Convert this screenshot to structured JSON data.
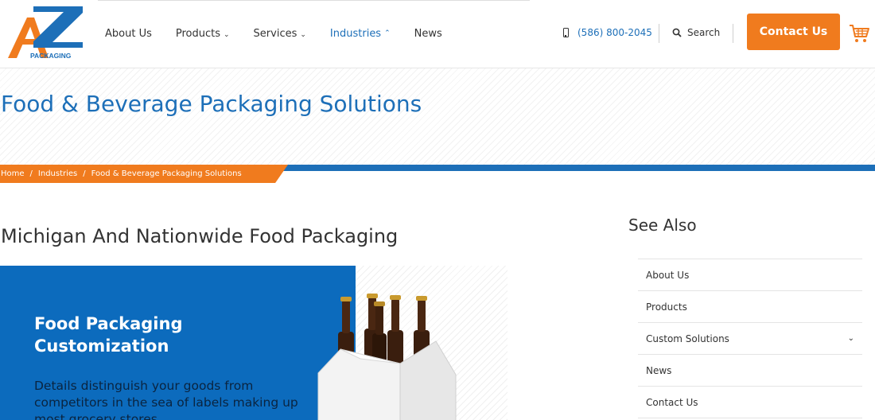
{
  "brand": {
    "logo_text": "AZ",
    "logo_subtext": "PACKAGING",
    "orange": "#f07b1e",
    "blue": "#1d6fb8"
  },
  "nav": {
    "items": [
      {
        "label": "About Us",
        "icon": ""
      },
      {
        "label": "Products",
        "icon": "chevron-down-icon"
      },
      {
        "label": "Services",
        "icon": "chevron-down-icon"
      },
      {
        "label": "Industries",
        "icon": "chevron-up-icon",
        "active": true
      },
      {
        "label": "News",
        "icon": ""
      }
    ]
  },
  "header": {
    "phone": "(586) 800-2045",
    "phone_icon": "mobile-phone-icon",
    "search_label": "Search",
    "search_icon": "search-icon",
    "contact_label": "Contact Us",
    "cart_icon": "shopping-cart-icon"
  },
  "page": {
    "title": "Food & Beverage Packaging Solutions"
  },
  "breadcrumb": {
    "items": [
      "Home",
      "Industries",
      "Food & Beverage Packaging Solutions"
    ],
    "separator": "/"
  },
  "main": {
    "section_title": "Michigan And Nationwide Food Packaging",
    "hero": {
      "title": "Food Packaging Customization",
      "text": "Details distinguish your goods from competitors in the sea of labels making up most grocery stores",
      "image": "six-pack-beer-bottle-carrier"
    }
  },
  "sidebar": {
    "title": "See Also",
    "items": [
      {
        "label": "About Us"
      },
      {
        "label": "Products"
      },
      {
        "label": "Custom Solutions",
        "icon": "chevron-down-icon"
      },
      {
        "label": "News"
      },
      {
        "label": "Contact Us"
      }
    ]
  }
}
